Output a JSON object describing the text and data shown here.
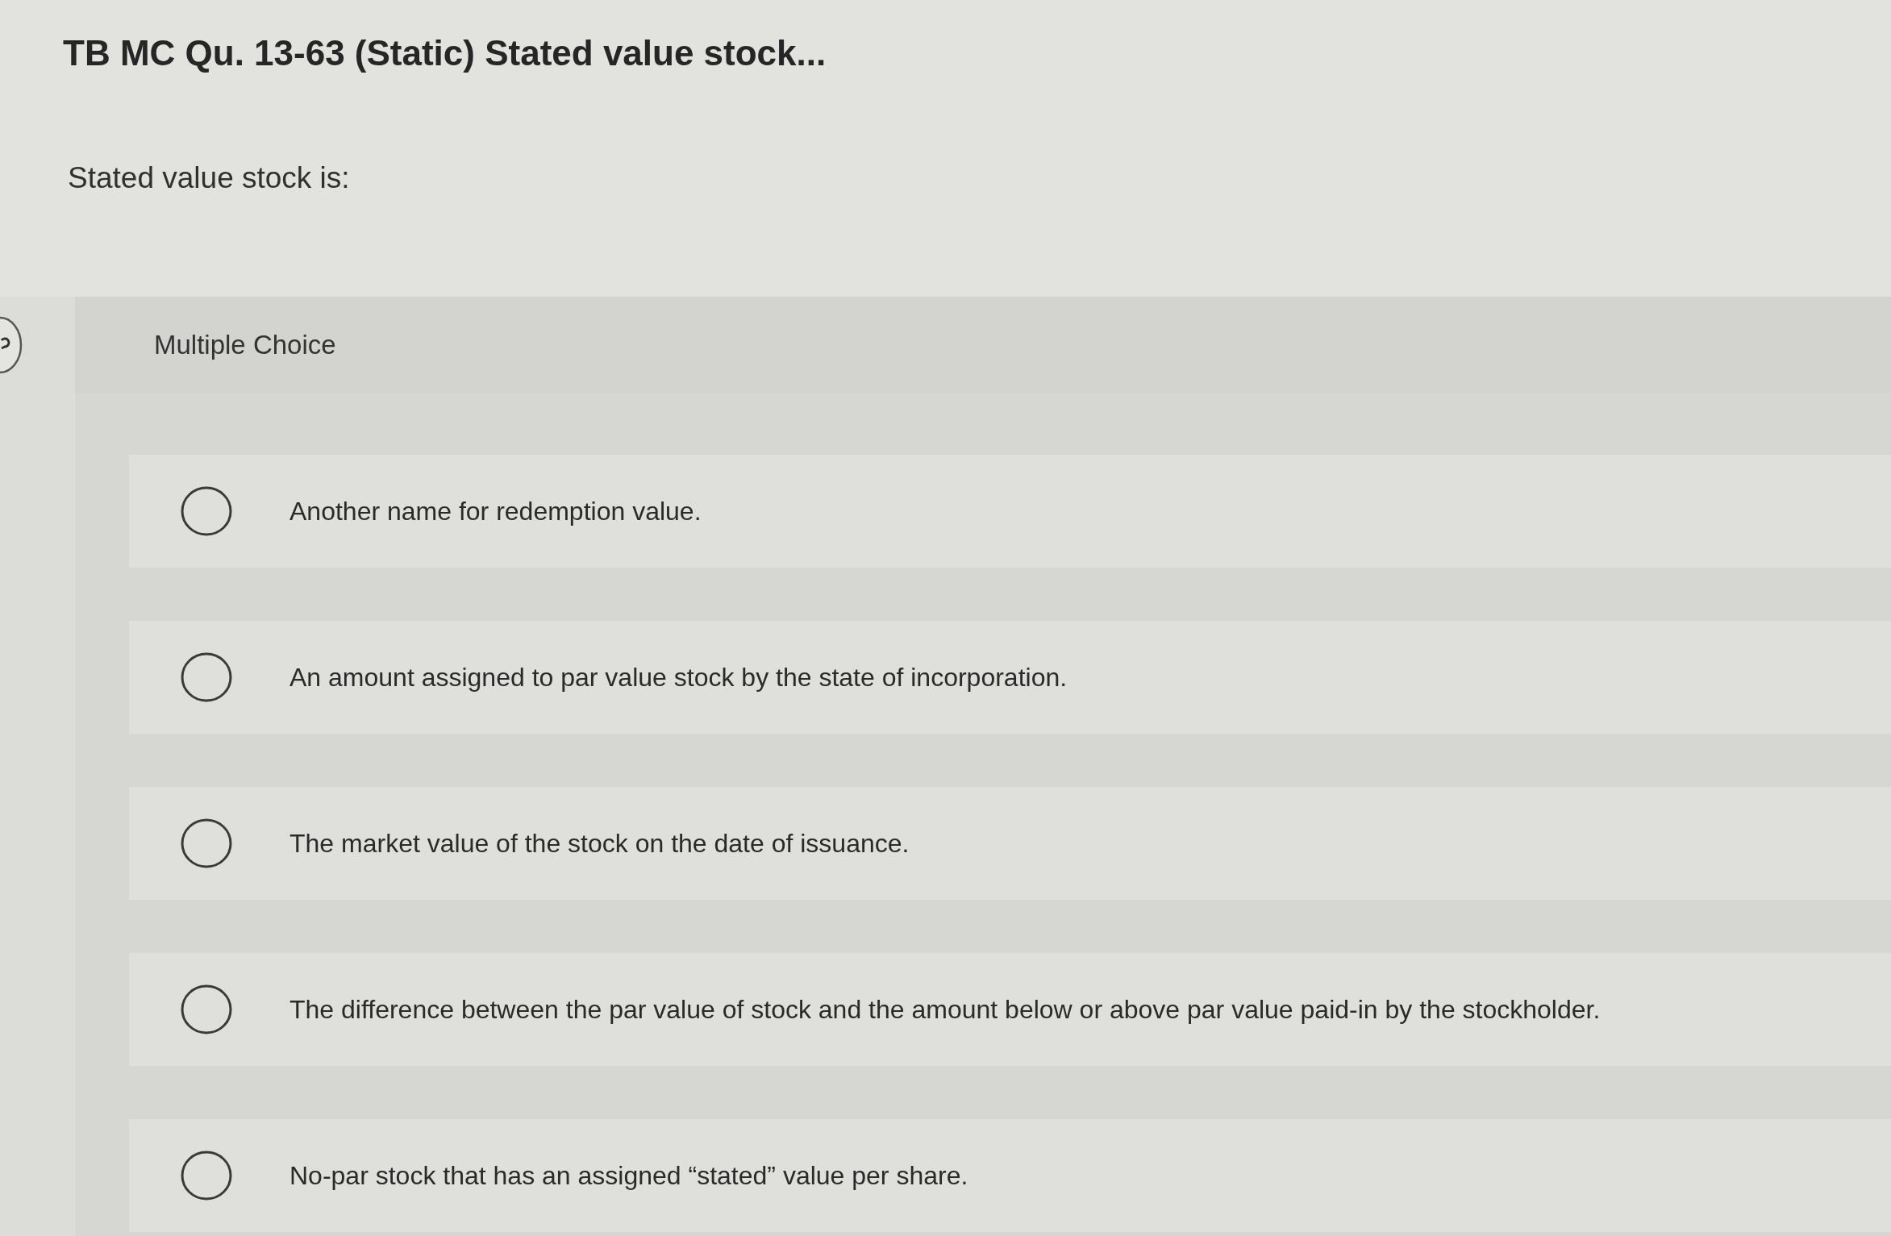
{
  "question": {
    "title": "TB MC Qu. 13-63 (Static) Stated value stock...",
    "prompt": "Stated value stock is:"
  },
  "answer_section": {
    "label": "Multiple Choice"
  },
  "options": [
    {
      "text": "Another name for redemption value.",
      "selected": false
    },
    {
      "text": "An amount assigned to par value stock by the state of incorporation.",
      "selected": false
    },
    {
      "text": "The market value of the stock on the date of issuance.",
      "selected": false
    },
    {
      "text": "The difference between the par value of stock and the amount below or above par value paid-in by the stockholder.",
      "selected": false
    },
    {
      "text": "No-par stock that has an assigned “stated” value per share.",
      "selected": false
    }
  ]
}
